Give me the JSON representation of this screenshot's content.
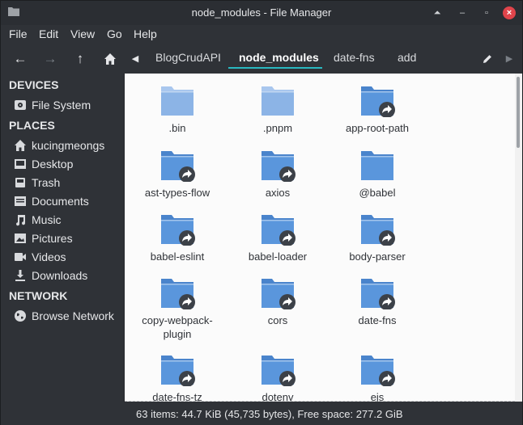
{
  "window": {
    "title": "node_modules - File Manager"
  },
  "menubar": {
    "items": [
      "File",
      "Edit",
      "View",
      "Go",
      "Help"
    ]
  },
  "toolbar": {
    "breadcrumbs": [
      "BlogCrudAPI",
      "node_modules",
      "date-fns",
      "add"
    ],
    "active_crumb": "node_modules"
  },
  "sidebar": {
    "devices_label": "DEVICES",
    "devices": [
      {
        "label": "File System",
        "icon": "drive-icon"
      }
    ],
    "places_label": "PLACES",
    "places": [
      {
        "label": "kucingmeongs",
        "icon": "home-icon"
      },
      {
        "label": "Desktop",
        "icon": "desktop-icon"
      },
      {
        "label": "Trash",
        "icon": "trash-icon"
      },
      {
        "label": "Documents",
        "icon": "documents-icon"
      },
      {
        "label": "Music",
        "icon": "music-icon"
      },
      {
        "label": "Pictures",
        "icon": "pictures-icon"
      },
      {
        "label": "Videos",
        "icon": "videos-icon"
      },
      {
        "label": "Downloads",
        "icon": "downloads-icon"
      }
    ],
    "network_label": "NETWORK",
    "network": [
      {
        "label": "Browse Network",
        "icon": "network-icon"
      }
    ]
  },
  "files": [
    {
      "name": ".bin",
      "link": false,
      "dim": true
    },
    {
      "name": ".pnpm",
      "link": false,
      "dim": true
    },
    {
      "name": "app-root-path",
      "link": true,
      "dim": false
    },
    {
      "name": "ast-types-flow",
      "link": true,
      "dim": false
    },
    {
      "name": "axios",
      "link": true,
      "dim": false
    },
    {
      "name": "@babel",
      "link": false,
      "dim": false
    },
    {
      "name": "babel-eslint",
      "link": true,
      "dim": false
    },
    {
      "name": "babel-loader",
      "link": true,
      "dim": false
    },
    {
      "name": "body-parser",
      "link": true,
      "dim": false
    },
    {
      "name": "copy-webpack-plugin",
      "link": true,
      "dim": false
    },
    {
      "name": "cors",
      "link": true,
      "dim": false
    },
    {
      "name": "date-fns",
      "link": true,
      "dim": false
    },
    {
      "name": "date-fns-tz",
      "link": true,
      "dim": false
    },
    {
      "name": "dotenv",
      "link": true,
      "dim": false
    },
    {
      "name": "ejs",
      "link": true,
      "dim": false
    }
  ],
  "status": {
    "text": "63 items: 44.7 KiB (45,735 bytes), Free space: 277.2 GiB"
  },
  "colors": {
    "accent": "#2ab9c1",
    "folder": "#5a96dc",
    "folder_dim": "#8cb4e6",
    "emblem": "#3c4148"
  }
}
